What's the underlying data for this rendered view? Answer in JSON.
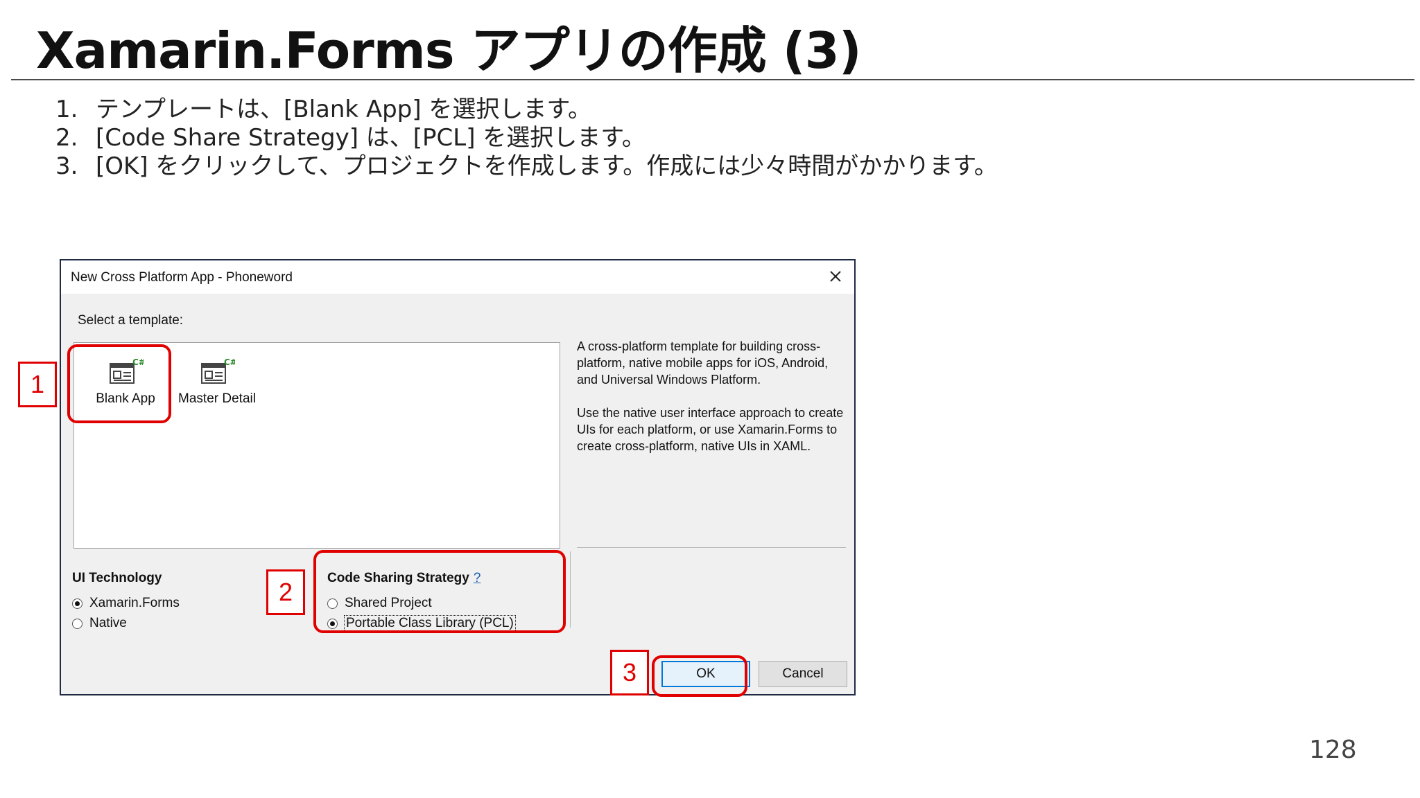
{
  "slide": {
    "title": "Xamarin.Forms アプリの作成 (3)",
    "page_number": "128",
    "steps": [
      {
        "num": "1.",
        "text": "テンプレートは、[Blank App] を選択します。"
      },
      {
        "num": "2.",
        "text": "[Code Share Strategy] は、[PCL] を選択します。"
      },
      {
        "num": "3.",
        "text": "[OK] をクリックして、プロジェクトを作成します。作成には少々時間がかかります。"
      }
    ]
  },
  "dialog": {
    "title": "New Cross Platform App - Phoneword",
    "close_icon": "close-icon",
    "select_template_label": "Select a template:",
    "templates": [
      {
        "label": "Blank App",
        "icon": "csharp-blank-app-icon",
        "selected": true
      },
      {
        "label": "Master Detail",
        "icon": "csharp-master-detail-icon",
        "selected": false
      }
    ],
    "description": [
      "A cross-platform template for building cross-platform, native mobile apps for iOS, Android, and Universal Windows Platform.",
      "Use the native user interface approach to create UIs for each platform, or use Xamarin.Forms to create cross-platform, native UIs in XAML."
    ],
    "ui_technology": {
      "heading": "UI Technology",
      "options": [
        {
          "label": "Xamarin.Forms",
          "checked": true
        },
        {
          "label": "Native",
          "checked": false
        }
      ]
    },
    "code_sharing": {
      "heading": "Code Sharing Strategy",
      "help": "?",
      "options": [
        {
          "label": "Shared Project",
          "checked": false
        },
        {
          "label": "Portable Class Library (PCL)",
          "checked": true
        }
      ]
    },
    "ok_label": "OK",
    "cancel_label": "Cancel"
  },
  "annotations": {
    "badge_1": "1",
    "badge_2": "2",
    "badge_3": "3",
    "color": "#e00000"
  }
}
